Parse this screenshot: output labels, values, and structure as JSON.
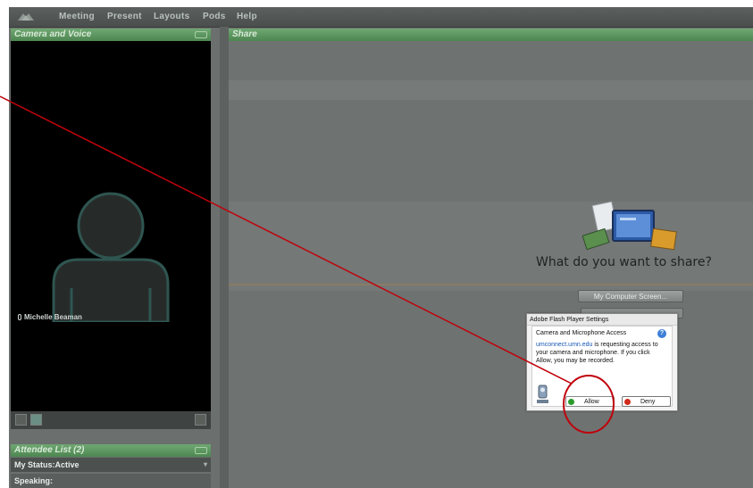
{
  "menubar": {
    "items": [
      "Meeting",
      "Present",
      "Layouts",
      "Pods",
      "Help"
    ]
  },
  "camera_pod": {
    "title": "Camera and Voice",
    "user_name": "Michelle Beaman"
  },
  "attendee_pod": {
    "title": "Attendee List (2)",
    "my_status": "My Status:Active",
    "speaking": "Speaking:"
  },
  "share_pod": {
    "title": "Share",
    "question": "What do you want to share?",
    "screen_button": "My Computer Screen..."
  },
  "flash_dialog": {
    "title": "Adobe Flash Player Settings",
    "heading": "Camera and Microphone Access",
    "link": "umconnect.umn.edu",
    "body": " is requesting access to your camera and microphone. If you click Allow, you may be recorded.",
    "allow_label": "Allow",
    "deny_label": "Deny",
    "help_symbol": "?"
  },
  "icons": [
    "connect-logo-icon",
    "microphone-icon",
    "fullscreen-icon",
    "share-documents-icon",
    "webcam-icon",
    "help-icon",
    "allow-radio-icon",
    "deny-radio-icon"
  ],
  "colors": {
    "pod_header": "#5d9660",
    "annotation": "#c0000b",
    "allow_green": "#2a9a2a",
    "deny_red": "#d02a1a"
  }
}
